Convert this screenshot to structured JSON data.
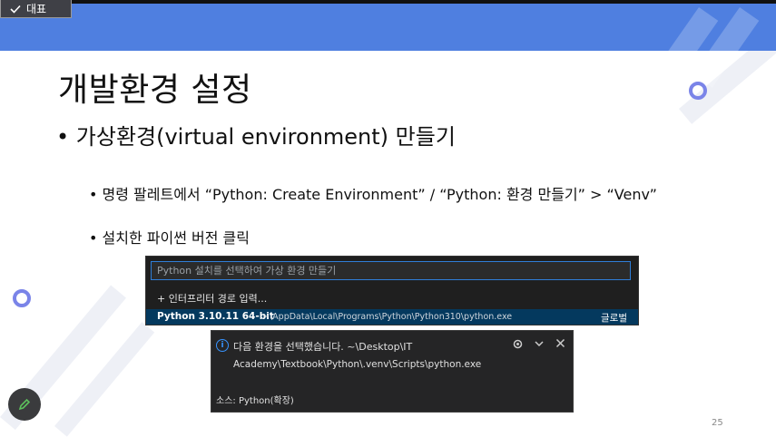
{
  "toolbar": {
    "rep_label": "대표"
  },
  "slide": {
    "title": "개발환경 설정",
    "bullet_main": "• 가상환경(virtual environment) 만들기",
    "bullet_step1": "•  명령 팔레트에서 “Python: Create Environment” / “Python: 환경 만들기” > “Venv”",
    "bullet_step2": "•  설치한 파이썬 버전 클릭",
    "page_number": "25"
  },
  "picker": {
    "placeholder": "Python 설치를 선택하여 가상 환경 만들기",
    "enter_interpreter": "+ 인터프리터 경로 입력...",
    "selected_version": "Python 3.10.11 64-bit",
    "selected_path": "~\\AppData\\Local\\Programs\\Python\\Python310\\python.exe",
    "selected_badge": "글로벌"
  },
  "notification": {
    "message_line1": "다음 환경을 선택했습니다. ~\\Desktop\\IT",
    "message_line2": "Academy\\Textbook\\Python\\.venv\\Scripts\\python.exe",
    "source": "소스: Python(확장)"
  },
  "colors": {
    "banner": "#4f7fe0",
    "accent_ring": "#7a84e8",
    "vscode_select": "#04395e",
    "vscode_focus": "#2f7ed8"
  },
  "icons": [
    "check-icon",
    "plus-icon",
    "info-icon",
    "gear-icon",
    "chevron-down-icon",
    "close-icon",
    "pencil-icon"
  ]
}
